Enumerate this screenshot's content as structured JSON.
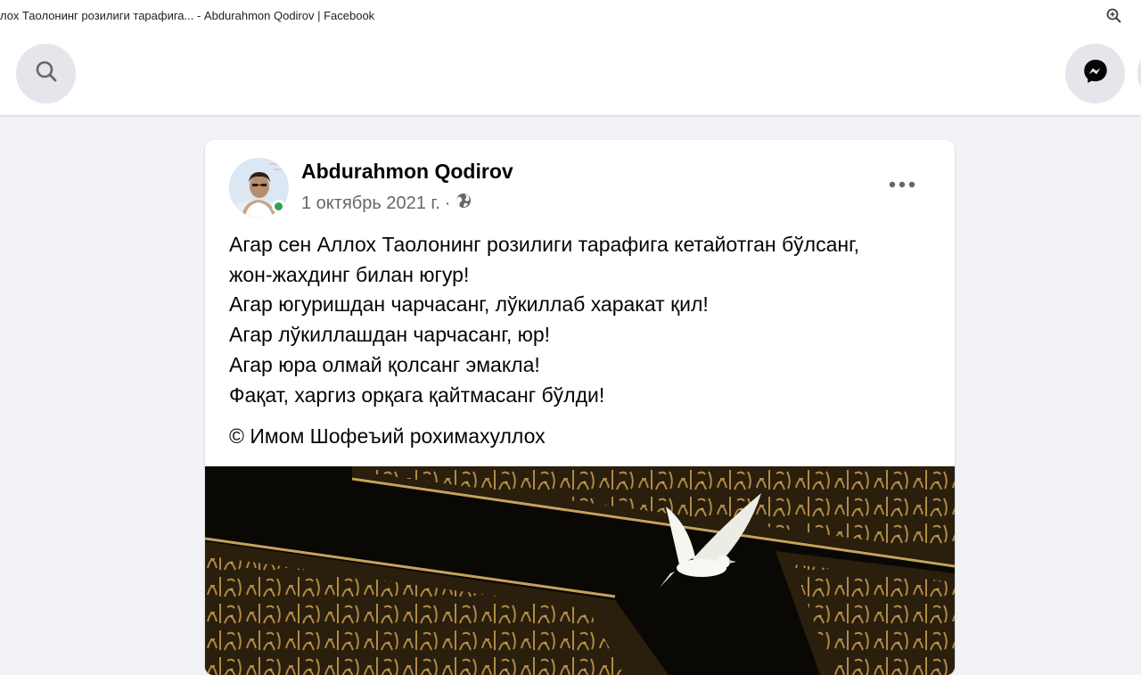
{
  "window": {
    "title": "лох Таолонинг розилиги тарафига... - Abdurahmon Qodirov | Facebook",
    "zoom_icon": "zoom-in-icon"
  },
  "topbar": {
    "search_icon": "search-icon",
    "messenger_icon": "messenger-icon"
  },
  "post": {
    "author": "Abdurahmon Qodirov",
    "date": "1 октябрь 2021 г.",
    "separator": "·",
    "privacy_icon": "globe-icon",
    "more_icon": "more-horizontal-icon",
    "online_status_color": "#31a24c",
    "text_lines": [
      "Агар сен Аллох Таолонинг розилиги тарафига кетайотган бўлсанг,",
      "жон-жахдинг билан югур!",
      "Агар югуришдан чарчасанг, лўкиллаб харакат қил!",
      "Агар лўкиллашдан чарчасанг, юр!",
      "Агар юра олмай қолсанг эмакла!",
      "Фақат, харгиз орқага қайтмасанг бўлди!"
    ],
    "credit": "© Имом Шофеъий рохимахуллох",
    "image_description_icon": "kaaba-calligraphy-dove-image"
  },
  "colors": {
    "page_background": "#f0f2f5",
    "card_background": "#ffffff",
    "secondary_text": "#65676b",
    "button_background": "#e4e6eb"
  }
}
